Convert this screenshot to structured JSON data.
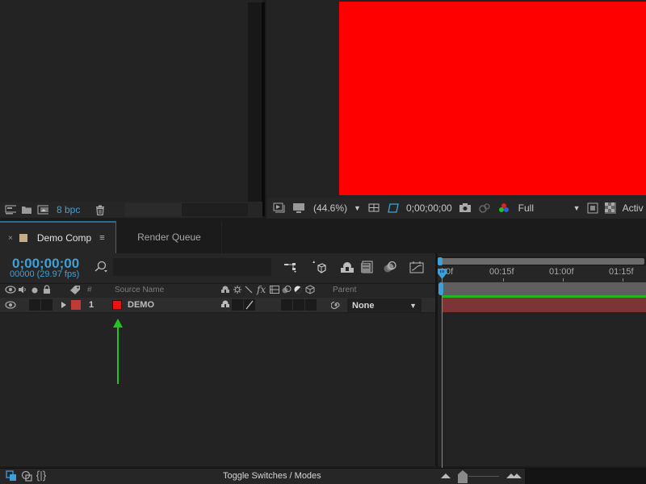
{
  "project_panel": {
    "bit_depth": "8 bpc",
    "icons": [
      "interpret-footage-icon",
      "new-folder-icon",
      "new-composition-icon",
      "trash-icon"
    ]
  },
  "viewer": {
    "composition_color": "#ff0000",
    "magnification": "(44.6%)",
    "timecode": "0;00;00;00",
    "resolution": "Full",
    "camera": "Activ",
    "icons": [
      "always-preview-icon",
      "monitor-icon",
      "grid-guides-icon",
      "mask-visibility-icon",
      "snapshot-icon",
      "show-snapshot-icon",
      "color-channels-icon",
      "region-of-interest-icon",
      "transparency-grid-icon"
    ]
  },
  "tabs": [
    {
      "label": "Demo Comp",
      "active": true,
      "swatch_color": "#c2ad86"
    },
    {
      "label": "Render Queue",
      "active": false
    }
  ],
  "tab_close": "×",
  "tab_menu": "≡",
  "timeline": {
    "timecode": "0;00;00;00",
    "frame_info": "00000 (29.97 fps)",
    "search_placeholder": "",
    "columns": {
      "source_name": "Source Name",
      "number": "#",
      "parent": "Parent",
      "fx": "fx"
    },
    "layers": [
      {
        "number": "1",
        "name": "DEMO",
        "label_color": "#c13a3a",
        "source_color": "#ee1111",
        "parent": "None"
      }
    ],
    "ruler": {
      "labels": [
        "0f",
        "00:15f",
        "01:00f",
        "01:15f"
      ]
    },
    "colors": {
      "accent": "#3fa0d8",
      "layer_bar": "#7c3434",
      "green_line": "#25b325"
    }
  },
  "bottom_bar": {
    "toggle_label": "Toggle Switches / Modes"
  },
  "annotation": {
    "arrow_color": "#22c422"
  }
}
